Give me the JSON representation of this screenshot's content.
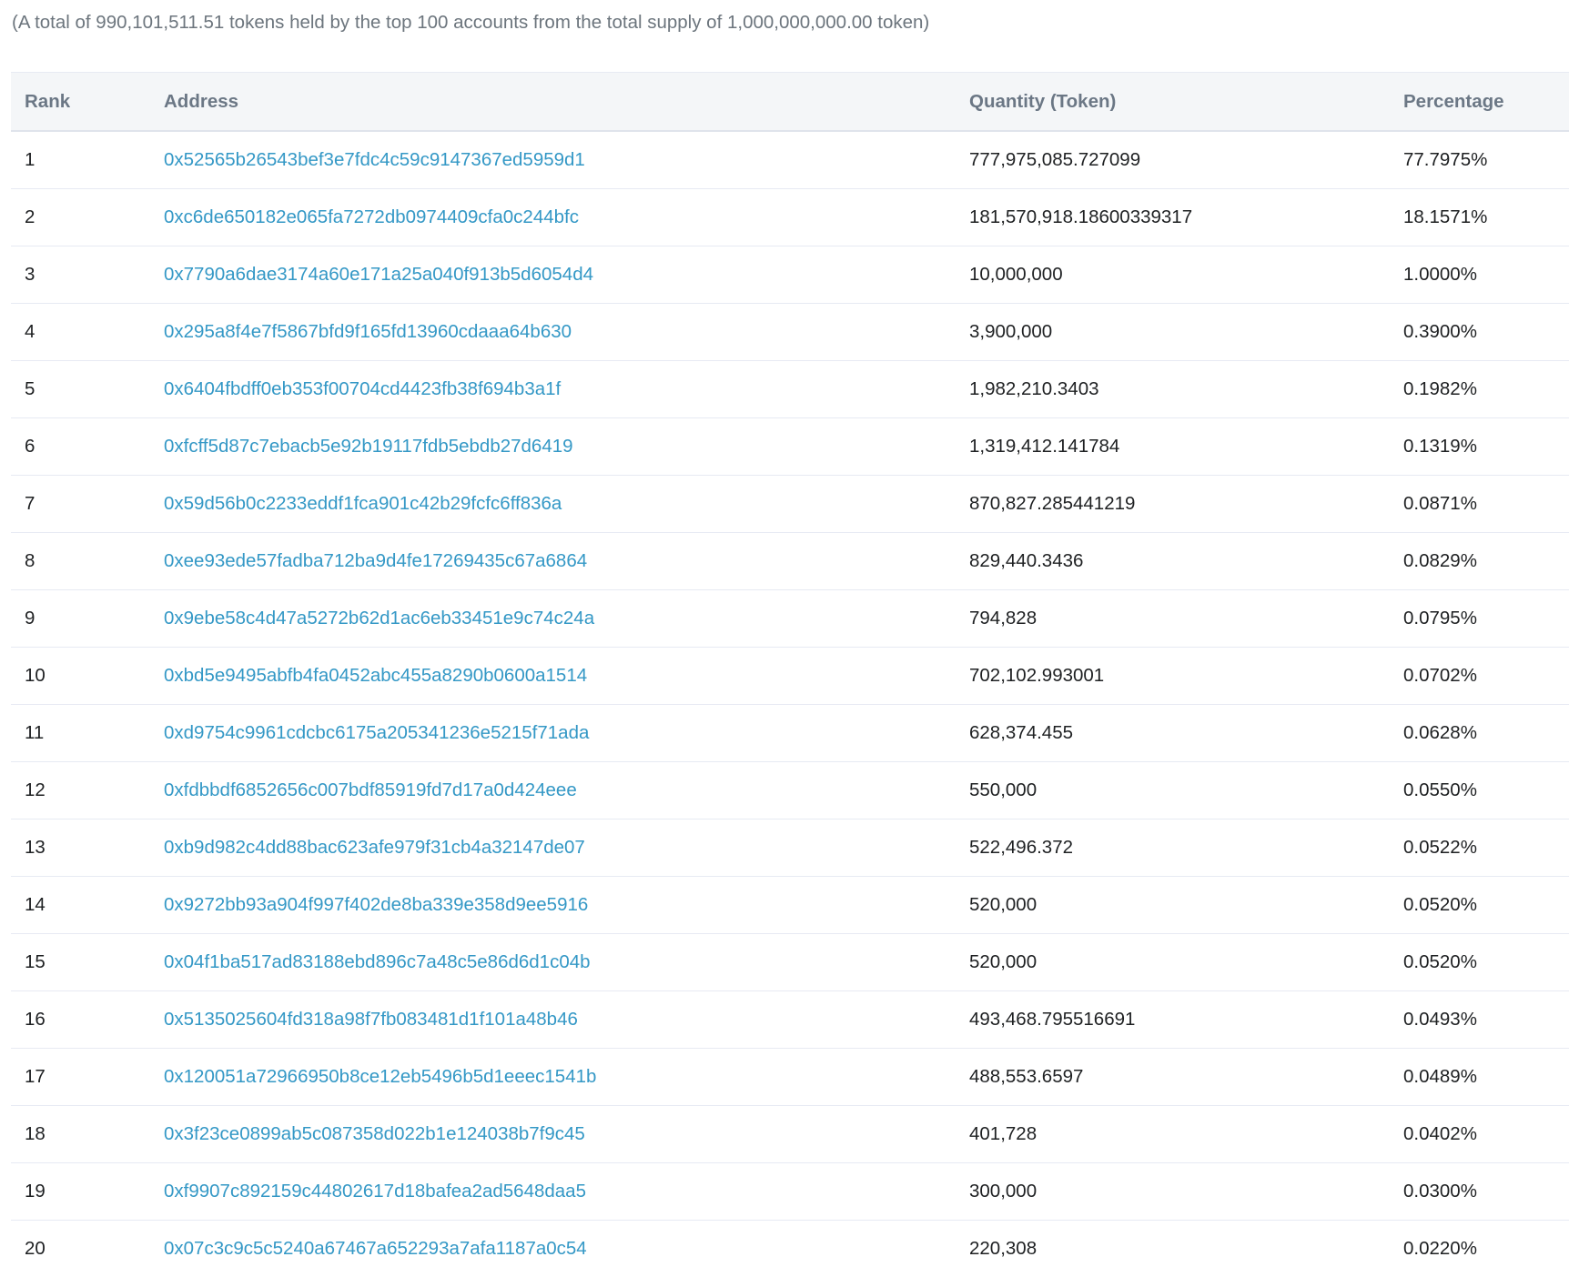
{
  "summary": "(A total of 990,101,511.51 tokens held by the top 100 accounts from the total supply of 1,000,000,000.00 token)",
  "table": {
    "headers": {
      "rank": "Rank",
      "address": "Address",
      "quantity": "Quantity (Token)",
      "percentage": "Percentage"
    },
    "rows": [
      {
        "rank": "1",
        "address": "0x52565b26543bef3e7fdc4c59c9147367ed5959d1",
        "quantity": "777,975,085.727099",
        "percentage": "77.7975%"
      },
      {
        "rank": "2",
        "address": "0xc6de650182e065fa7272db0974409cfa0c244bfc",
        "quantity": "181,570,918.18600339317",
        "percentage": "18.1571%"
      },
      {
        "rank": "3",
        "address": "0x7790a6dae3174a60e171a25a040f913b5d6054d4",
        "quantity": "10,000,000",
        "percentage": "1.0000%"
      },
      {
        "rank": "4",
        "address": "0x295a8f4e7f5867bfd9f165fd13960cdaaa64b630",
        "quantity": "3,900,000",
        "percentage": "0.3900%"
      },
      {
        "rank": "5",
        "address": "0x6404fbdff0eb353f00704cd4423fb38f694b3a1f",
        "quantity": "1,982,210.3403",
        "percentage": "0.1982%"
      },
      {
        "rank": "6",
        "address": "0xfcff5d87c7ebacb5e92b19117fdb5ebdb27d6419",
        "quantity": "1,319,412.141784",
        "percentage": "0.1319%"
      },
      {
        "rank": "7",
        "address": "0x59d56b0c2233eddf1fca901c42b29fcfc6ff836a",
        "quantity": "870,827.285441219",
        "percentage": "0.0871%"
      },
      {
        "rank": "8",
        "address": "0xee93ede57fadba712ba9d4fe17269435c67a6864",
        "quantity": "829,440.3436",
        "percentage": "0.0829%"
      },
      {
        "rank": "9",
        "address": "0x9ebe58c4d47a5272b62d1ac6eb33451e9c74c24a",
        "quantity": "794,828",
        "percentage": "0.0795%"
      },
      {
        "rank": "10",
        "address": "0xbd5e9495abfb4fa0452abc455a8290b0600a1514",
        "quantity": "702,102.993001",
        "percentage": "0.0702%"
      },
      {
        "rank": "11",
        "address": "0xd9754c9961cdcbc6175a205341236e5215f71ada",
        "quantity": "628,374.455",
        "percentage": "0.0628%"
      },
      {
        "rank": "12",
        "address": "0xfdbbdf6852656c007bdf85919fd7d17a0d424eee",
        "quantity": "550,000",
        "percentage": "0.0550%"
      },
      {
        "rank": "13",
        "address": "0xb9d982c4dd88bac623afe979f31cb4a32147de07",
        "quantity": "522,496.372",
        "percentage": "0.0522%"
      },
      {
        "rank": "14",
        "address": "0x9272bb93a904f997f402de8ba339e358d9ee5916",
        "quantity": "520,000",
        "percentage": "0.0520%"
      },
      {
        "rank": "15",
        "address": "0x04f1ba517ad83188ebd896c7a48c5e86d6d1c04b",
        "quantity": "520,000",
        "percentage": "0.0520%"
      },
      {
        "rank": "16",
        "address": "0x5135025604fd318a98f7fb083481d1f101a48b46",
        "quantity": "493,468.795516691",
        "percentage": "0.0493%"
      },
      {
        "rank": "17",
        "address": "0x120051a72966950b8ce12eb5496b5d1eeec1541b",
        "quantity": "488,553.6597",
        "percentage": "0.0489%"
      },
      {
        "rank": "18",
        "address": "0x3f23ce0899ab5c087358d022b1e124038b7f9c45",
        "quantity": "401,728",
        "percentage": "0.0402%"
      },
      {
        "rank": "19",
        "address": "0xf9907c892159c44802617d18bafea2ad5648daa5",
        "quantity": "300,000",
        "percentage": "0.0300%"
      },
      {
        "rank": "20",
        "address": "0x07c3c9c5c5240a67467a652293a7afa1187a0c54",
        "quantity": "220,308",
        "percentage": "0.0220%"
      }
    ]
  },
  "colors": {
    "link": "#3498c6",
    "header_bg": "#f4f6f8",
    "muted_text": "#6c757d",
    "body_text": "#1e2022",
    "row_border": "#e7eaf3"
  }
}
